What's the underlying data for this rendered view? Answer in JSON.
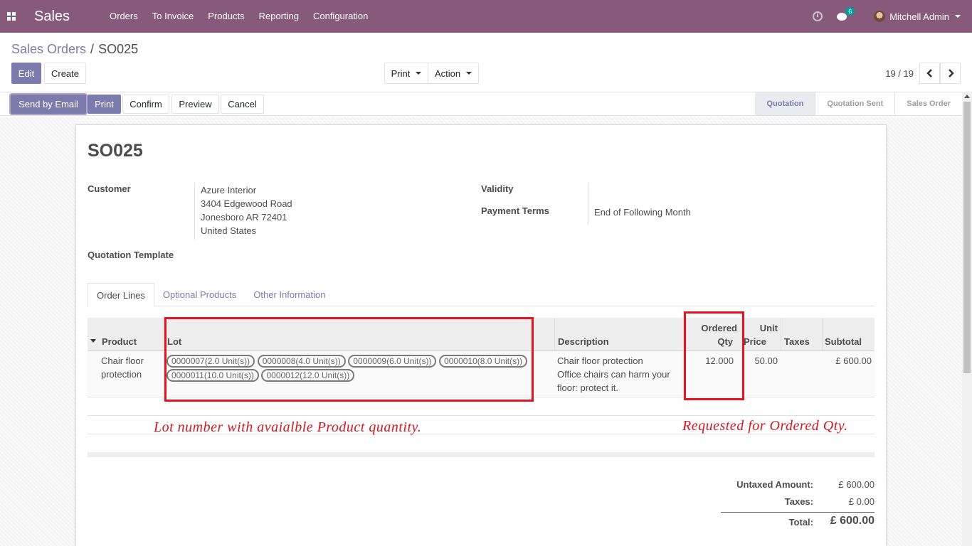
{
  "nav": {
    "app_name": "Sales",
    "menu": [
      "Orders",
      "To Invoice",
      "Products",
      "Reporting",
      "Configuration"
    ],
    "chat_count": "6",
    "user_name": "Mitchell Admin",
    "icons": [
      "apps-icon",
      "clock-icon",
      "chat-icon",
      "avatar"
    ]
  },
  "breadcrumb": {
    "parent": "Sales Orders",
    "separator": "/",
    "current": "SO025"
  },
  "buttons": {
    "edit": "Edit",
    "create": "Create",
    "print_dropdown": "Print",
    "action_dropdown": "Action"
  },
  "pager": {
    "value": "19 / 19",
    "prev": "‹",
    "next": "›"
  },
  "statusbar": {
    "send_email": "Send by Email",
    "print": "Print",
    "confirm": "Confirm",
    "preview": "Preview",
    "cancel": "Cancel",
    "stages": [
      "Quotation",
      "Quotation Sent",
      "Sales Order"
    ],
    "active_stage": "Quotation"
  },
  "form": {
    "title": "SO025",
    "customer_label": "Customer",
    "customer_name": "Azure Interior",
    "address_line1": "3404 Edgewood Road",
    "address_line2": "Jonesboro AR 72401",
    "address_line3": "United States",
    "template_label": "Quotation Template",
    "validity_label": "Validity",
    "payment_terms_label": "Payment Terms",
    "payment_terms_value": "End of Following Month"
  },
  "tabs": [
    "Order Lines",
    "Optional Products",
    "Other Information"
  ],
  "table": {
    "headers": {
      "product": "Product",
      "lot": "Lot",
      "description": "Description",
      "ordered_qty_1": "Ordered",
      "ordered_qty_2": "Qty",
      "unit_price_1": "Unit",
      "unit_price_2": "Price",
      "taxes": "Taxes",
      "subtotal": "Subtotal"
    },
    "row": {
      "product_1": "Chair floor",
      "product_2": "protection",
      "lots": [
        "0000007(2.0 Unit(s))",
        "0000008(4.0 Unit(s))",
        "0000009(6.0 Unit(s))",
        "0000010(8.0 Unit(s))",
        "0000011(10.0 Unit(s))",
        "0000012(12.0 Unit(s))"
      ],
      "description_1": "Chair floor protection",
      "description_2": "Office chairs can harm your",
      "description_3": "floor: protect it.",
      "ordered_qty": "12.000",
      "unit_price": "50.00",
      "taxes": "",
      "subtotal": "£ 600.00"
    }
  },
  "annotations": {
    "lot_note": "Lot number with avaialble Product quantity.",
    "qty_note": "Requested for Ordered Qty.",
    "color": "#e8131e"
  },
  "totals": {
    "untaxed_label": "Untaxed Amount:",
    "untaxed_value": "£ 600.00",
    "taxes_label": "Taxes:",
    "taxes_value": "£ 0.00",
    "total_label": "Total:",
    "total_value": "£ 600.00"
  },
  "colors": {
    "brand": "#875a7b",
    "link": "#7c7bad",
    "annotation": "#d4171f"
  }
}
